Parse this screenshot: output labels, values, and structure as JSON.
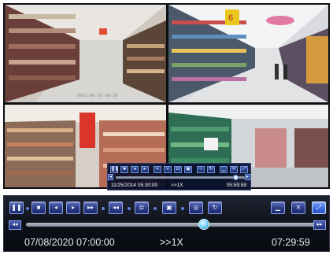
{
  "cameras": [
    {
      "id": "cam1",
      "stamp": "2014-06-16 08:30"
    },
    {
      "id": "cam2",
      "stamp": ""
    },
    {
      "id": "cam3",
      "stamp": ""
    },
    {
      "id": "cam4",
      "stamp": ""
    }
  ],
  "mini_player": {
    "start_time": "11/25/2014 05:30:00",
    "speed": ">>1X",
    "end_time": "05:59:59",
    "progress": 0.93
  },
  "main_player": {
    "start_time": "07/08/2020 07:00:00",
    "speed": ">>1X",
    "end_time": "07:29:59",
    "progress": 0.61
  },
  "icons": [
    "pause-icon",
    "stop-icon",
    "step-back-icon",
    "step-forward-icon",
    "fast-forward-icon",
    "rewind-icon",
    "snapshot-icon",
    "save-clip-icon",
    "zoom-icon",
    "loop-icon",
    "minimize-icon",
    "close-icon",
    "fullscreen-icon"
  ],
  "colors": {
    "accent": "#3e6be0",
    "bar_bg": "#0c0f16",
    "button": "#2b3a86"
  }
}
